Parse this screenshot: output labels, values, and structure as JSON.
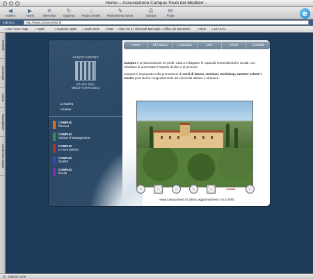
{
  "window": {
    "title": "Home – Associazione Campus Studi del Mediterr..."
  },
  "toolbar": {
    "buttons": [
      {
        "label": "Indietro",
        "icon": "back-arrow-icon",
        "glyph": "◀"
      },
      {
        "label": "Avanti",
        "icon": "forward-arrow-icon",
        "glyph": "▶"
      },
      {
        "label": "Interrompi",
        "icon": "stop-icon",
        "glyph": "✕"
      },
      {
        "label": "Aggiorna",
        "icon": "refresh-icon",
        "glyph": "↻"
      },
      {
        "label": "Pagina iniziale",
        "icon": "home-icon",
        "glyph": "⌂"
      },
      {
        "label": "Riempimento autom.",
        "icon": "autofill-icon",
        "glyph": "✎"
      },
      {
        "label": "Stampa",
        "icon": "print-icon",
        "glyph": "⎙"
      },
      {
        "label": "Posta",
        "icon": "mail-icon",
        "glyph": "✉"
      }
    ]
  },
  "address": {
    "label": "Indirizzo",
    "value": "http://www.campusmed.it/"
  },
  "favorites": [
    "Live Home Page",
    "Apple",
    "Supporto Apple",
    "Apple Store",
    "iMac",
    "Mac OS X",
    "Microsoft MacTopia",
    "Office per Macintosh",
    "MSN",
    "127.0.0.1"
  ],
  "side_tabs": [
    "Preferiti",
    "Cronologia",
    "Cerca",
    "Raccoglitore",
    "Contenitore pagine"
  ],
  "status": {
    "text": "Internet zone"
  },
  "site": {
    "logo": {
      "top": "ASSOCIAZIONE",
      "bottom": "STUDI DEL MEDITERRANEO"
    },
    "intro_links": [
      "La laurea",
      "I master"
    ],
    "campus_items": [
      {
        "line1": "CAMPUS",
        "line2": "Ricerca",
        "color": "#e0702a"
      },
      {
        "line1": "CAMPUS",
        "line2": "School of Management",
        "color": "#2f9a36"
      },
      {
        "line1": "CAMPUS",
        "line2": "e i suoi partner",
        "color": "#c32b2b"
      },
      {
        "line1": "CAMPUS",
        "line2": "Qualità",
        "color": "#3346c2"
      },
      {
        "line1": "CAMPUS",
        "line2": "Eventi",
        "color": "#7d2fb0"
      }
    ],
    "nav": [
      "Home",
      "Chi siamo",
      "I Campus",
      "Link",
      "Avvisi",
      "Contatti"
    ],
    "paragraph1": {
      "strong": "Campus",
      "rest": " è un'associazione no profit, volta a sviluppare le capacità imprenditoriali e sociali, con l'obiettivo di aumentare il rispetto di idee e di persone."
    },
    "paragraph2": {
      "part1": "Campus è impegnato nella promozione di ",
      "bold1": "corsi di laurea, seminari, workshop, summer school",
      "part2": " e ",
      "bold2": "master",
      "part3": " post laurea congiuntamente ad università italiane e straniere."
    },
    "seal_text": "COMIE",
    "footer": "www.campusmed.it  |  ultimo aggiornamento 5-12-2005"
  }
}
